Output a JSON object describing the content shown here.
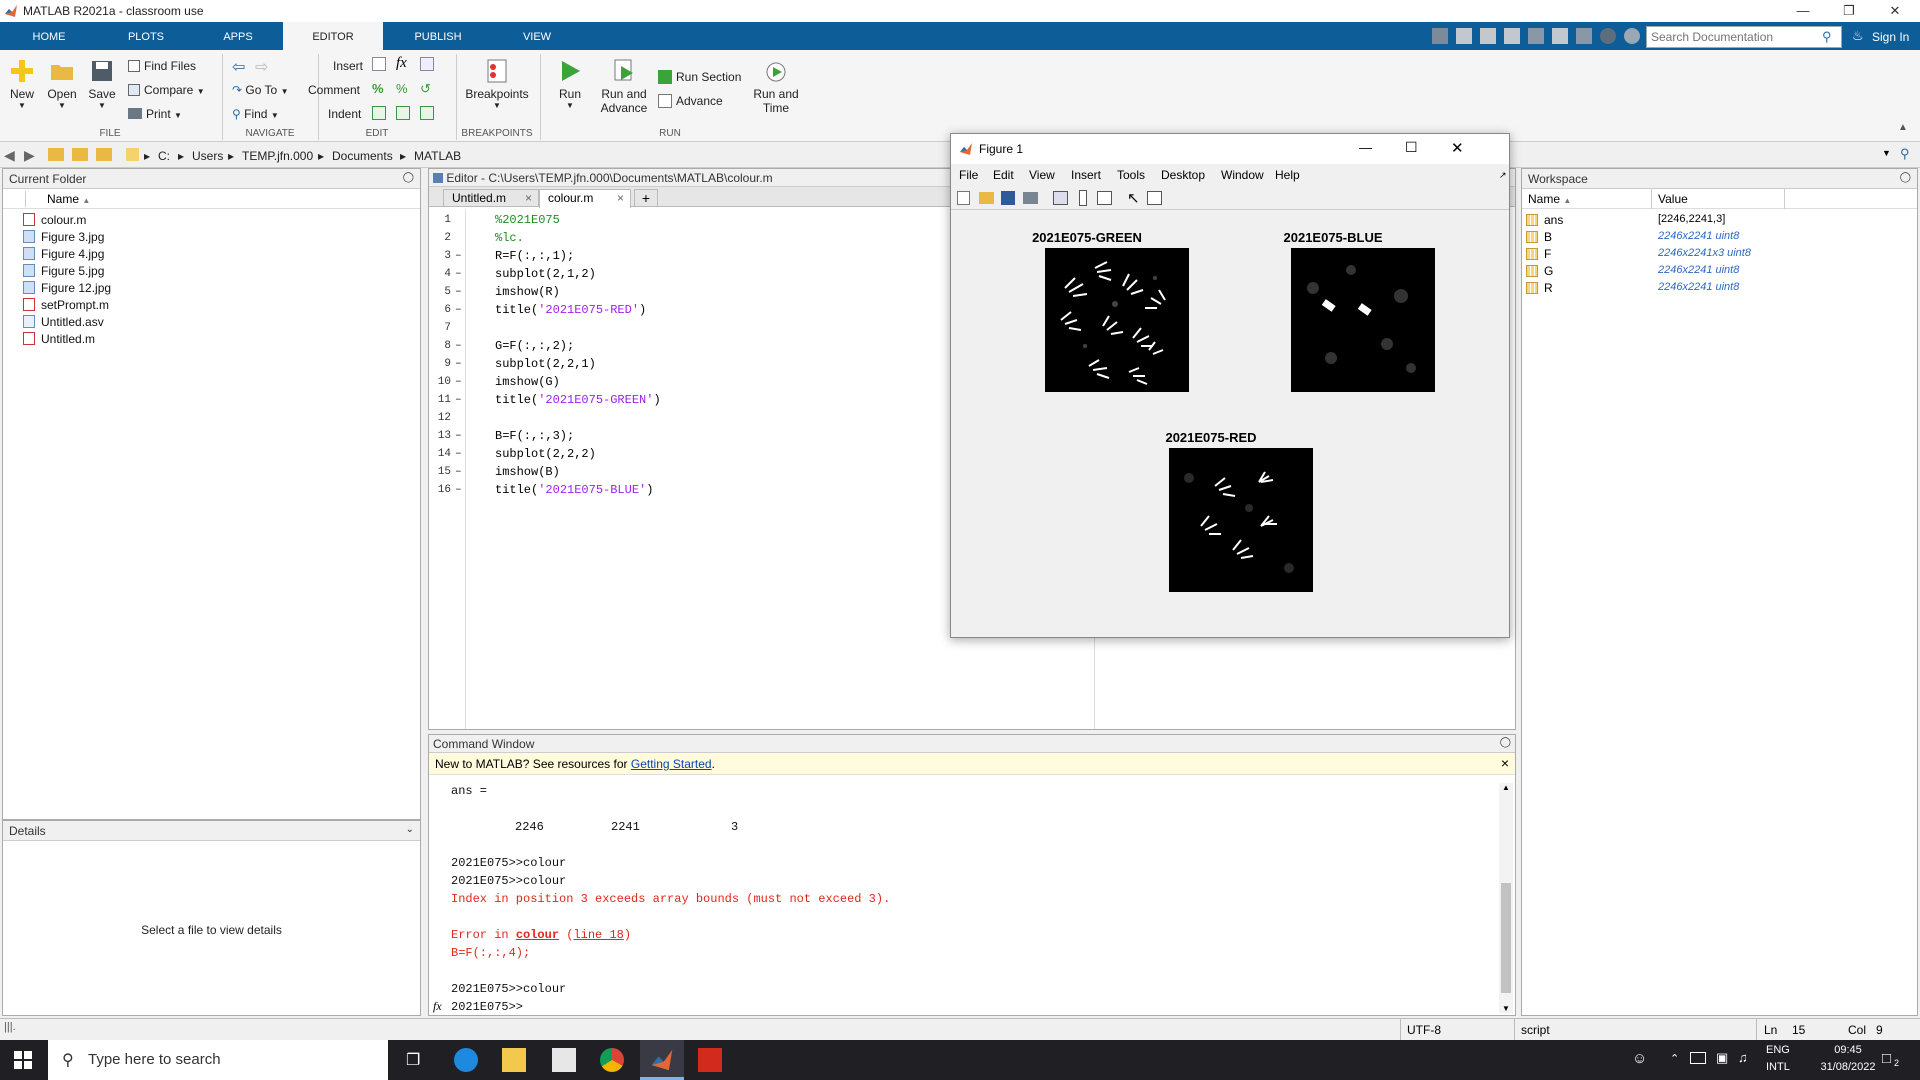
{
  "window": {
    "title": "MATLAB R2021a - classroom use"
  },
  "tabs": [
    "HOME",
    "PLOTS",
    "APPS",
    "EDITOR",
    "PUBLISH",
    "VIEW"
  ],
  "active_tab": "EDITOR",
  "search": {
    "placeholder": "Search Documentation"
  },
  "sign_in": "Sign In",
  "ribbon": {
    "file": {
      "new": "New",
      "open": "Open",
      "save": "Save",
      "find_files": "Find Files",
      "compare": "Compare",
      "print": "Print",
      "group": "FILE"
    },
    "navigate": {
      "goto": "Go To",
      "find": "Find",
      "group": "NAVIGATE"
    },
    "edit": {
      "insert": "Insert",
      "comment": "Comment",
      "indent": "Indent",
      "group": "EDIT"
    },
    "breakpoints": {
      "label": "Breakpoints",
      "group": "BREAKPOINTS"
    },
    "run": {
      "run": "Run",
      "run_advance_1": "Run and",
      "run_advance_2": "Advance",
      "run_section": "Run Section",
      "advance": "Advance",
      "run_time_1": "Run and",
      "run_time_2": "Time",
      "group": "RUN"
    }
  },
  "path": [
    "C:",
    "Users",
    "TEMP.jfn.000",
    "Documents",
    "MATLAB"
  ],
  "current_folder": {
    "title": "Current Folder",
    "column": "Name",
    "files": [
      "colour.m",
      "Figure 3.jpg",
      "Figure 4.jpg",
      "Figure 5.jpg",
      "Figure 12.jpg",
      "setPrompt.m",
      "Untitled.asv",
      "Untitled.m"
    ]
  },
  "details": {
    "title": "Details",
    "placeholder": "Select a file to view details"
  },
  "editor": {
    "title": "Editor - C:\\Users\\TEMP.jfn.000\\Documents\\MATLAB\\colour.m",
    "tabs": [
      "Untitled.m",
      "colour.m"
    ],
    "lines": [
      "%2021E075",
      "%lc.",
      "R=F(:,:,1);",
      "subplot(2,1,2)",
      "imshow(R)",
      "title('2021E075-RED')",
      "",
      "G=F(:,:,2);",
      "subplot(2,2,1)",
      "imshow(G)",
      "title('2021E075-GREEN')",
      "",
      "B=F(:,:,3);",
      "subplot(2,2,2)",
      "imshow(B)",
      "title('2021E075-BLUE')"
    ]
  },
  "command_window": {
    "title": "Command Window",
    "banner_text": "New to MATLAB? See resources for ",
    "banner_link": "Getting Started",
    "banner_end": ".",
    "ans_label": "ans =",
    "ans_values": [
      "2246",
      "2241",
      "3"
    ],
    "cmd1": "2021E075>>colour",
    "cmd2": "2021E075>>colour",
    "error_msg": "Index in position 3 exceeds array bounds (must not exceed 3).",
    "error_in": "Error in ",
    "error_fn": "colour",
    "error_line": "line 18",
    "error_code": "B=F(:,:,4);",
    "cmd3": "2021E075>>colour",
    "prompt": "2021E075>>"
  },
  "workspace": {
    "title": "Workspace",
    "col_name": "Name",
    "col_value": "Value",
    "vars": [
      {
        "name": "ans",
        "value": "[2246,2241,3]"
      },
      {
        "name": "B",
        "value": "2246x2241 uint8"
      },
      {
        "name": "F",
        "value": "2246x2241x3 uint8"
      },
      {
        "name": "G",
        "value": "2246x2241 uint8"
      },
      {
        "name": "R",
        "value": "2246x2241 uint8"
      }
    ]
  },
  "figure": {
    "title": "Figure 1",
    "menu": [
      "File",
      "Edit",
      "View",
      "Insert",
      "Tools",
      "Desktop",
      "Window",
      "Help"
    ],
    "axes": [
      "2021E075-GREEN",
      "2021E075-BLUE",
      "2021E075-RED"
    ]
  },
  "status": {
    "encoding": "UTF-8",
    "type": "script",
    "ln_label": "Ln",
    "ln": "15",
    "col_label": "Col",
    "col": "9"
  },
  "taskbar": {
    "search_placeholder": "Type here to search",
    "lang1": "ENG",
    "lang2": "INTL",
    "time": "09:45",
    "date": "31/08/2022",
    "notifications": "2"
  }
}
